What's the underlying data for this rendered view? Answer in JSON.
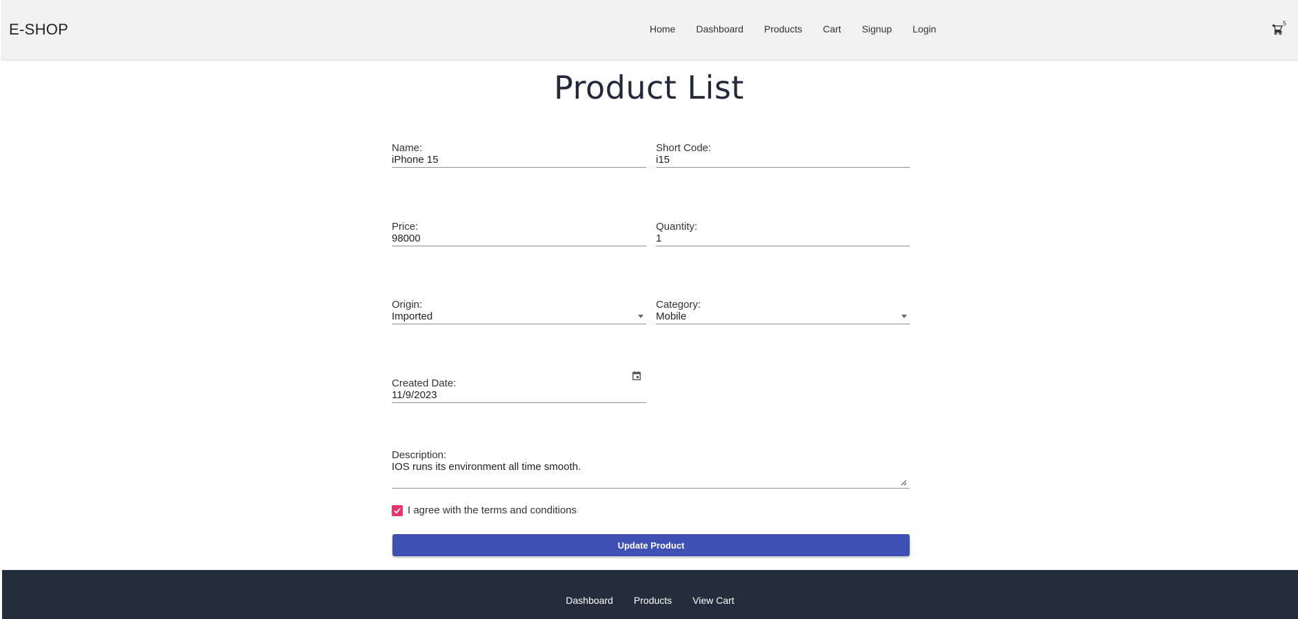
{
  "navbar": {
    "brand": "E-SHOP",
    "links": [
      "Home",
      "Dashboard",
      "Products",
      "Cart",
      "Signup",
      "Login"
    ],
    "cart_count": "5"
  },
  "page": {
    "title": "Product List"
  },
  "form": {
    "name": {
      "label": "Name:",
      "value": "iPhone 15"
    },
    "short_code": {
      "label": "Short Code:",
      "value": "i15"
    },
    "price": {
      "label": "Price:",
      "value": "98000"
    },
    "quantity": {
      "label": "Quantity:",
      "value": "1"
    },
    "origin": {
      "label": "Origin:",
      "value": "Imported"
    },
    "category": {
      "label": "Category:",
      "value": "Mobile"
    },
    "created_date": {
      "label": "Created Date:",
      "value": "11/9/2023"
    },
    "description": {
      "label": "Description:",
      "value": "IOS runs its environment all time smooth."
    },
    "terms": {
      "label": "I agree with the terms and conditions",
      "checked": true
    },
    "submit_label": "Update Product"
  },
  "footer": {
    "links": [
      "Dashboard",
      "Products",
      "View Cart"
    ]
  },
  "colors": {
    "primary": "#3f51b5",
    "checkbox": "#e6356f",
    "footer_bg": "#232d3c",
    "navbar_bg": "#f2f2f2"
  }
}
